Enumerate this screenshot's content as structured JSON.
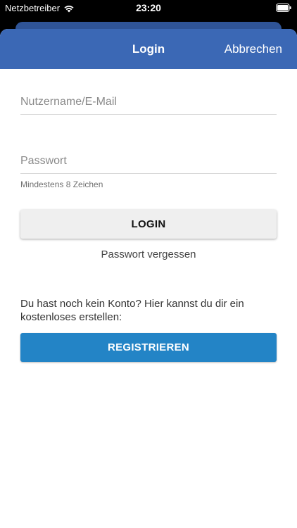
{
  "status_bar": {
    "carrier": "Netzbetreiber",
    "time": "23:20",
    "wifi_icon": "wifi-icon",
    "battery_icon": "battery-icon"
  },
  "navbar": {
    "title": "Login",
    "cancel_label": "Abbrechen",
    "color": "#3b68b5"
  },
  "form": {
    "username_placeholder": "Nutzername/E-Mail",
    "username_value": "",
    "password_placeholder": "Passwort",
    "password_value": "",
    "password_hint": "Mindestens 8 Zeichen",
    "login_label": "LOGIN",
    "forgot_label": "Passwort vergessen"
  },
  "register": {
    "text": "Du hast noch kein Konto? Hier kannst du dir ein kostenloses erstellen:",
    "button_label": "REGISTRIEREN",
    "color": "#2384c6"
  }
}
